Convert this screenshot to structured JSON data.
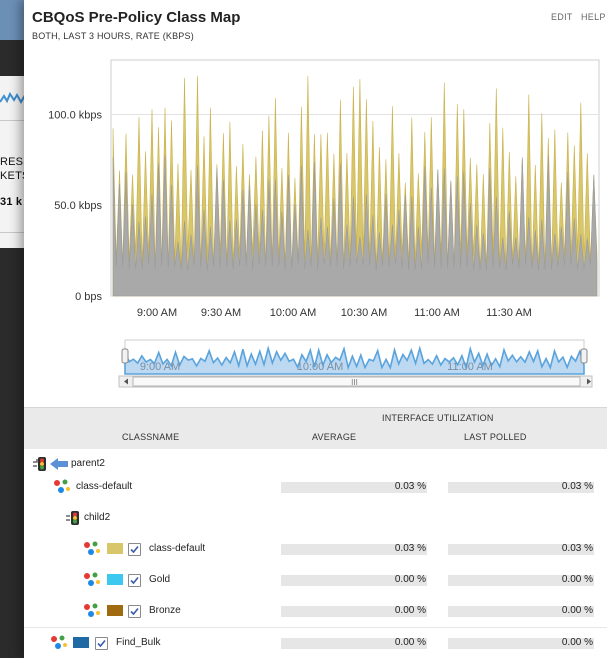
{
  "background_window": {
    "lines": [
      "RESS",
      "KETS",
      "31 k"
    ]
  },
  "header": {
    "title": "CBQoS Pre-Policy Class Map",
    "subtitle": "BOTH, LAST 3 HOURS, RATE (KBPS)",
    "edit_label": "EDIT",
    "help_label": "HELP"
  },
  "chart_data": {
    "type": "area",
    "title": "",
    "xlabel": "",
    "ylabel": "",
    "ylim": [
      0,
      130
    ],
    "y_ticks": [
      {
        "value": 0,
        "label": "0 bps"
      },
      {
        "value": 50,
        "label": "50.0 kbps"
      },
      {
        "value": 100,
        "label": "100.0 kbps"
      }
    ],
    "x_ticks": [
      "9:00 AM",
      "9:30 AM",
      "10:00 AM",
      "10:30 AM",
      "11:00 AM",
      "11:30 AM"
    ],
    "grid": true,
    "series": [
      {
        "color": "#d8c66a",
        "level": "yellow peaks roughly 60–125 kbps, troughs near 15–20 kbps"
      },
      {
        "color": "#a9a9a9",
        "level": "gray peaks roughly 40–80 kbps, base near 15 kbps"
      }
    ],
    "navigator": {
      "labels": [
        "9:00 AM",
        "10:00 AM",
        "11:00 AM"
      ],
      "scroll_label": "III",
      "color": "#5aa3dc"
    }
  },
  "table": {
    "group_header": "INTERFACE UTILIZATION",
    "columns": [
      "CLASSNAME",
      "AVERAGE",
      "LAST POLLED"
    ],
    "rows": [
      {
        "name": "parent2",
        "avg": "",
        "last": ""
      },
      {
        "name": "class-default",
        "avg": "0.03 %",
        "last": "0.03 %"
      },
      {
        "name": "child2",
        "avg": "",
        "last": ""
      },
      {
        "name": "class-default",
        "avg": "0.03 %",
        "last": "0.03 %",
        "color": "#d8c66a",
        "checked": true
      },
      {
        "name": "Gold",
        "avg": "0.00 %",
        "last": "0.00 %",
        "color": "#3cc8ef",
        "checked": true
      },
      {
        "name": "Bronze",
        "avg": "0.00 %",
        "last": "0.00 %",
        "color": "#a06a10",
        "checked": true
      },
      {
        "name": "Find_Bulk",
        "avg": "0.00 %",
        "last": "0.00 %",
        "color": "#1f6aa5",
        "checked": true
      }
    ]
  },
  "colors": {
    "yellow_series": "#d8c66a",
    "gray_series": "#a9a9a9",
    "navigator_fill": "#5aa3dc"
  }
}
